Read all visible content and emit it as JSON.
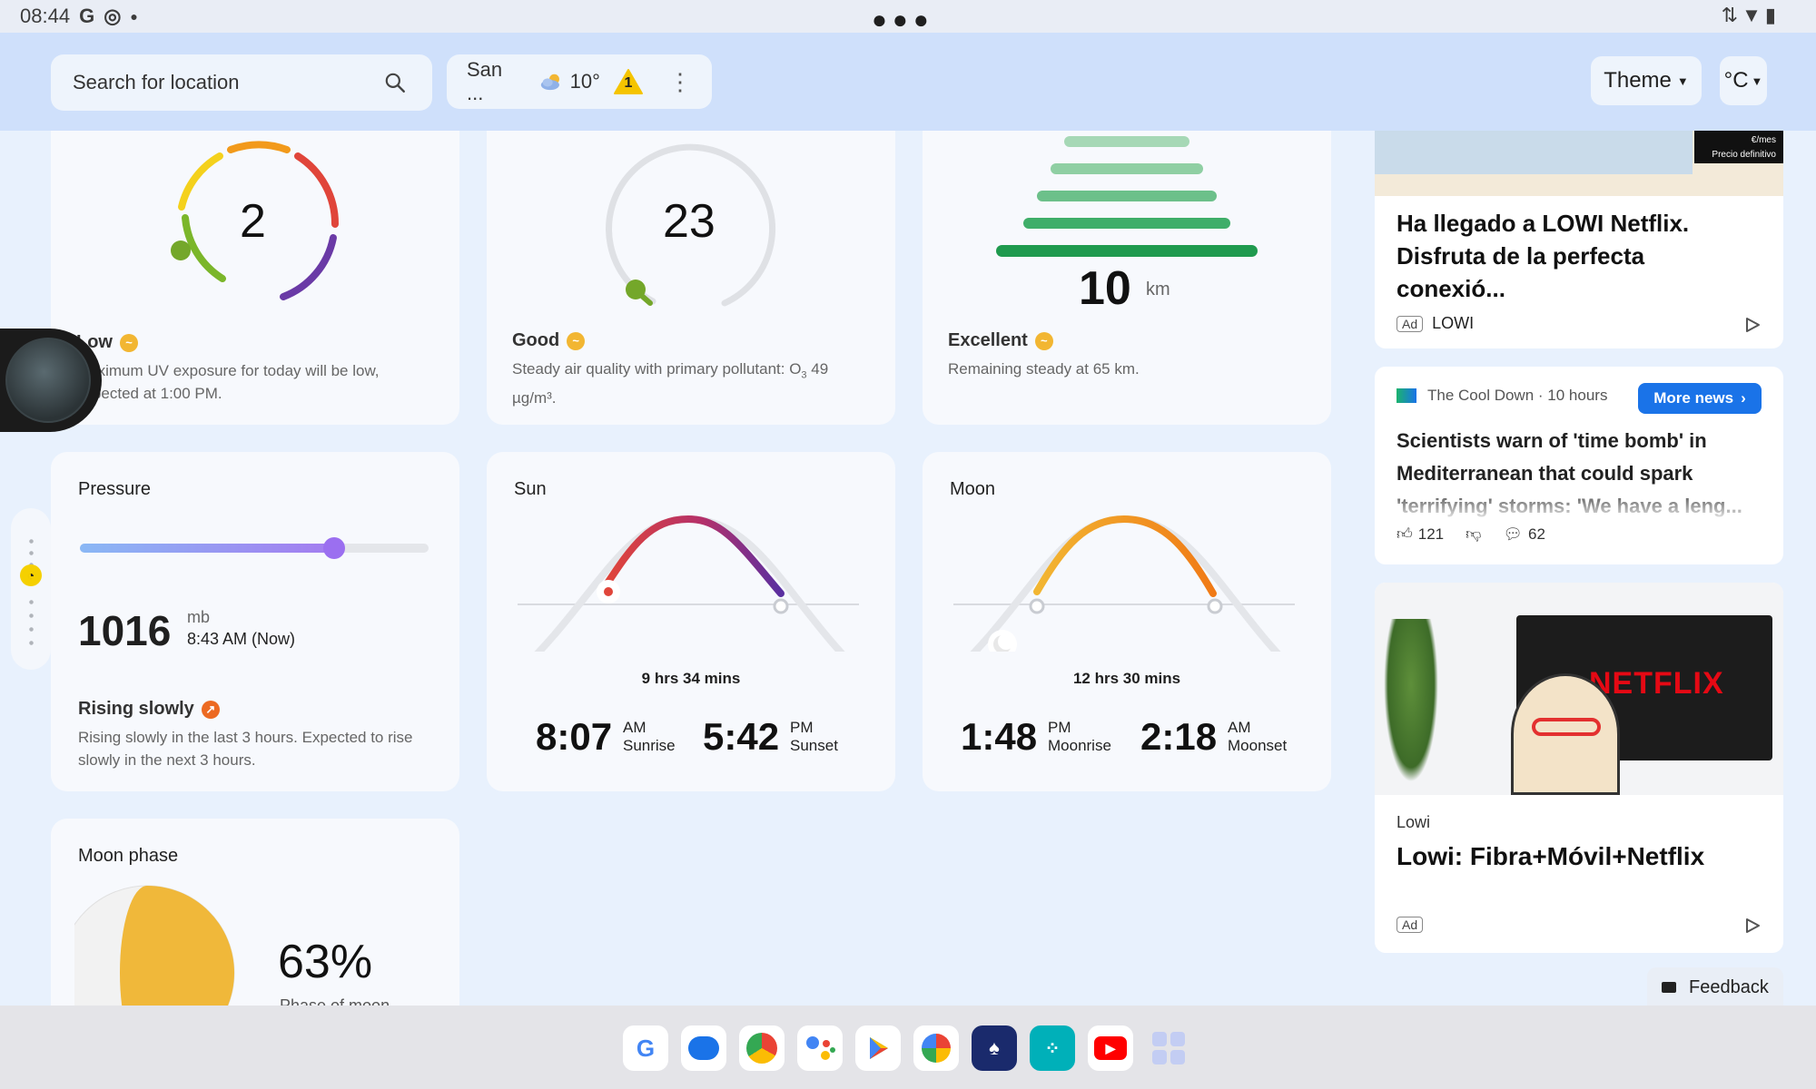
{
  "status_bar": {
    "time": "08:44",
    "g_icon": "G"
  },
  "header": {
    "search_placeholder": "Search for location",
    "location_short": "San ...",
    "location_temp": "10°",
    "alert_count": "1",
    "theme_label": "Theme",
    "unit_label": "°C"
  },
  "uv": {
    "value": "2",
    "status": "Low",
    "description": "Maximum UV exposure for today will be low, expected at 1:00 PM."
  },
  "aqi": {
    "value": "23",
    "status": "Good",
    "description_prefix": "Steady air quality with primary pollutant: O",
    "description_sub": "3",
    "description_suffix": " 49 µg/m³."
  },
  "visibility": {
    "value": "10",
    "unit": "km",
    "status": "Excellent",
    "description": "Remaining steady at 65 km."
  },
  "pressure": {
    "title": "Pressure",
    "value": "1016",
    "unit": "mb",
    "time": "8:43 AM (Now)",
    "level": 0.73,
    "status": "Rising slowly",
    "description": "Rising slowly in the last 3 hours. Expected to rise slowly in the next 3 hours."
  },
  "sun": {
    "title": "Sun",
    "duration": "9 hrs 34 mins",
    "rise_time": "8:07",
    "rise_ampm": "AM",
    "rise_label": "Sunrise",
    "set_time": "5:42",
    "set_ampm": "PM",
    "set_label": "Sunset"
  },
  "moon": {
    "title": "Moon",
    "duration": "12 hrs 30 mins",
    "rise_time": "1:48",
    "rise_ampm": "PM",
    "rise_label": "Moonrise",
    "set_time": "2:18",
    "set_ampm": "AM",
    "set_label": "Moonset"
  },
  "moon_phase": {
    "title": "Moon phase",
    "percent": "63%",
    "label": "Phase of moon"
  },
  "news": {
    "ad1": {
      "headline": "Ha llegado a LOWI Netflix. Disfruta de la perfecta conexió...",
      "ad_tag": "Ad",
      "advertiser": "LOWI",
      "thumb_text_1": "€/mes",
      "thumb_text_2": "Precio definitivo"
    },
    "article": {
      "source": "The Cool Down",
      "age": "10 hours",
      "more_news": "More news",
      "headline": "Scientists warn of 'time bomb' in Mediterranean that could spark 'terrifying' storms: 'We have a leng...",
      "likes": "121",
      "comments": "62"
    },
    "ad2": {
      "image_text": "NETFLIX",
      "advertiser": "Lowi",
      "headline": "Lowi: Fibra+Móvil+Netflix",
      "ad_tag": "Ad"
    }
  },
  "feedback_label": "Feedback",
  "dock_apps": [
    "google",
    "messages",
    "chrome",
    "assistant",
    "play-store",
    "photos",
    "solitaire",
    "fitbit",
    "youtube",
    "app-drawer"
  ]
}
